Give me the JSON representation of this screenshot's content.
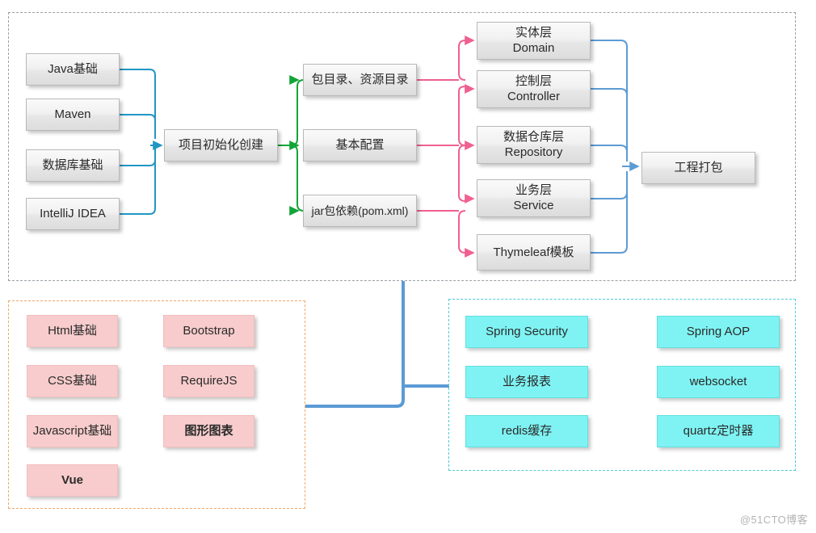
{
  "diagram": {
    "watermark": "@51CTO博客",
    "colors": {
      "grey_node_bg": "#eeeeee",
      "pink_node_bg": "#f8cccc",
      "cyan_node_bg": "#7ff3f3",
      "wire_blue": "#2196c4",
      "wire_green": "#13a438",
      "wire_pink": "#f0608f",
      "wire_lightblue": "#5b9bd5",
      "group_top_border": "#9aa0a6",
      "group_front_border": "#f0a868",
      "group_adv_border": "#4ecbd6"
    },
    "groups": [
      {
        "id": "backend-flow",
        "name": "top-dashed-group"
      },
      {
        "id": "frontend-skills",
        "name": "frontend-dashed-group"
      },
      {
        "id": "advanced-topics",
        "name": "advanced-dashed-group"
      }
    ],
    "prereq_nodes": [
      {
        "label": "Java基础"
      },
      {
        "label": "Maven"
      },
      {
        "label": "数据库基础"
      },
      {
        "label": "IntelliJ IDEA"
      }
    ],
    "init_node": {
      "label": "项目初始化创建"
    },
    "init_children": [
      {
        "label": "包目录、资源目录"
      },
      {
        "label": "基本配置"
      },
      {
        "label": "jar包依赖(pom.xml)"
      }
    ],
    "layer_nodes": [
      {
        "line1": "实体层",
        "line2": "Domain"
      },
      {
        "line1": "控制层",
        "line2": "Controller"
      },
      {
        "line1": "数据仓库层",
        "line2": "Repository"
      },
      {
        "line1": "业务层",
        "line2": "Service"
      },
      {
        "line1": "Thymeleaf模板",
        "line2": ""
      }
    ],
    "package_node": {
      "label": "工程打包"
    },
    "frontend_nodes": [
      {
        "label": "Html基础",
        "bold": false
      },
      {
        "label": "Bootstrap",
        "bold": false
      },
      {
        "label": "CSS基础",
        "bold": false
      },
      {
        "label": "RequireJS",
        "bold": false
      },
      {
        "label": "Javascript基础",
        "bold": false
      },
      {
        "label": "图形图表",
        "bold": true
      },
      {
        "label": "Vue",
        "bold": true
      }
    ],
    "advanced_nodes": [
      {
        "label": "Spring Security"
      },
      {
        "label": "Spring AOP"
      },
      {
        "label": "业务报表"
      },
      {
        "label": "websocket"
      },
      {
        "label": "redis缓存"
      },
      {
        "label": "quartz定时器"
      }
    ]
  }
}
